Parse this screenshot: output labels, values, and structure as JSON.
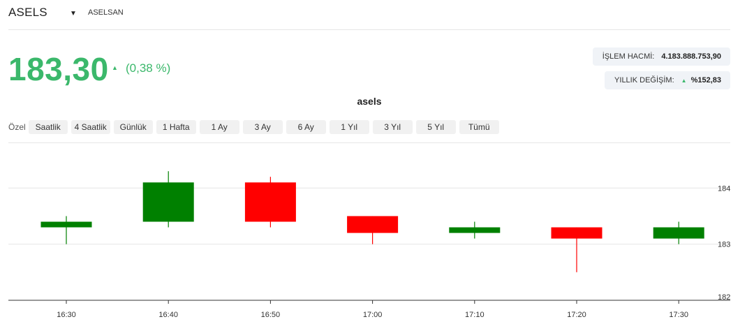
{
  "header": {
    "ticker": "ASELS",
    "caret_icon": "caret-down-icon",
    "company": "ASELSAN"
  },
  "quote": {
    "price": "183,30",
    "direction_icon": "triangle-up-icon",
    "change": "(0,38 %)"
  },
  "stats": {
    "volume_label": "İŞLEM HACMİ:",
    "volume_value": "4.183.888.753,90",
    "yearly_label": "YILLIK DEĞİŞİM:",
    "yearly_icon": "triangle-up-icon",
    "yearly_value": "%152,83"
  },
  "range": {
    "label": "Özel",
    "buttons": [
      "Saatlik",
      "4 Saatlik",
      "Günlük",
      "1 Hafta",
      "1 Ay",
      "3 Ay",
      "6 Ay",
      "1 Yıl",
      "3 Yıl",
      "5 Yıl",
      "Tümü"
    ]
  },
  "colors": {
    "up": "#008000",
    "down": "#ff0000",
    "price_green": "#3bb86b",
    "grid": "#e6e6e6"
  },
  "chart_data": {
    "type": "candlestick",
    "title": "asels",
    "x": [
      "16:30",
      "16:40",
      "16:50",
      "17:00",
      "17:10",
      "17:20",
      "17:30"
    ],
    "series": [
      {
        "open": [
          183.3,
          183.4,
          184.1,
          183.5,
          183.2,
          183.3,
          183.1
        ],
        "high": [
          183.5,
          184.3,
          184.2,
          183.5,
          183.4,
          183.3,
          183.4
        ],
        "low": [
          183.0,
          183.3,
          183.3,
          183.0,
          183.1,
          182.5,
          183.0
        ],
        "close": [
          183.4,
          184.1,
          183.4,
          183.2,
          183.3,
          183.1,
          183.3
        ]
      }
    ],
    "ylim": [
      182,
      184.8
    ],
    "yticks": [
      "182",
      "183",
      "184"
    ],
    "ytick_values": [
      182,
      183,
      184
    ],
    "y_axis_position": "right",
    "grid": true
  }
}
